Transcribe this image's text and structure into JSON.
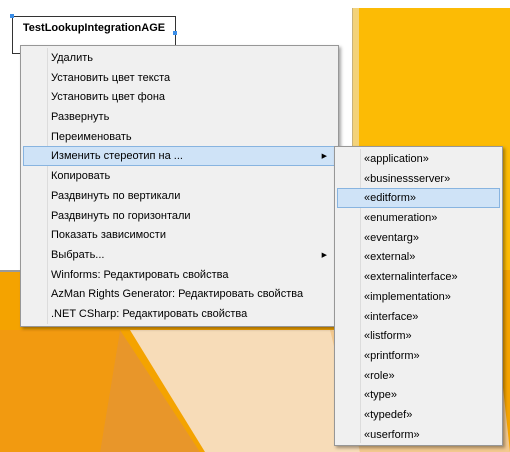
{
  "diagram": {
    "class_name": "TestLookupIntegrationAGE"
  },
  "context_menu": {
    "items": [
      {
        "label": "Удалить"
      },
      {
        "label": "Установить цвет текста"
      },
      {
        "label": "Установить цвет фона"
      },
      {
        "label": "Развернуть"
      },
      {
        "label": "Переименовать"
      },
      {
        "label": "Изменить стереотип на ...",
        "submenu": true,
        "highlighted": true
      },
      {
        "label": "Копировать"
      },
      {
        "label": "Раздвинуть по вертикали"
      },
      {
        "label": "Раздвинуть по горизонтали"
      },
      {
        "label": "Показать зависимости"
      },
      {
        "label": "Выбрать...",
        "submenu": true
      },
      {
        "label": "Winforms: Редактировать свойства"
      },
      {
        "label": "AzMan Rights Generator: Редактировать свойства"
      },
      {
        "label": ".NET CSharp: Редактировать свойства"
      }
    ]
  },
  "stereotype_submenu": {
    "items": [
      {
        "label": "«application»"
      },
      {
        "label": "«businessserver»"
      },
      {
        "label": "«editform»",
        "highlighted": true
      },
      {
        "label": "«enumeration»"
      },
      {
        "label": "«eventarg»"
      },
      {
        "label": "«external»"
      },
      {
        "label": "«externalinterface»"
      },
      {
        "label": "«implementation»"
      },
      {
        "label": "«interface»"
      },
      {
        "label": "«listform»"
      },
      {
        "label": "«printform»"
      },
      {
        "label": "«role»"
      },
      {
        "label": "«type»"
      },
      {
        "label": "«typedef»"
      },
      {
        "label": "«userform»"
      }
    ]
  },
  "colors": {
    "highlight": "#cfe3f7",
    "wallpaper": "#f5a800",
    "menu_bg": "#f0f0f0"
  },
  "icons": {
    "submenu_arrow": "chevron-right-icon"
  }
}
